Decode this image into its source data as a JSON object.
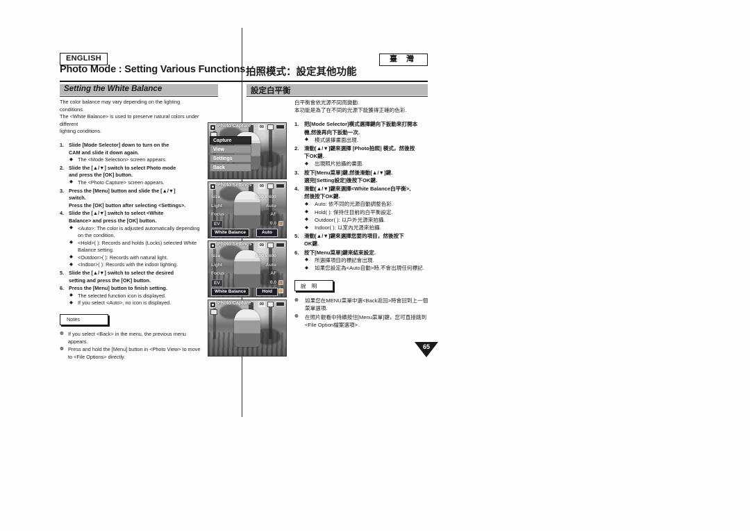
{
  "header": {
    "language_tag": "ENGLISH",
    "region_tag": "臺 灣",
    "title_en": "Photo Mode : Setting Various Functions",
    "title_zh": "拍照模式：設定其他功能"
  },
  "section": {
    "title_en": "Setting the White Balance",
    "title_zh": "設定白平衡"
  },
  "left": {
    "intro": [
      "The color balance may vary depending on the lighting conditions.",
      "The <White Balance> is used to preserve natural colors under different",
      "lighting conditions."
    ],
    "steps": [
      {
        "num": "1.",
        "lines": [
          "Slide [Mode Selector] down to turn on the",
          "CAM and slide it down again."
        ],
        "bullets": [
          "The <Mode Selection> screen appears."
        ]
      },
      {
        "num": "2.",
        "lines": [
          "Slide the [▲/▼] switch to select Photo mode",
          "and press the [OK] button."
        ],
        "bullets": [
          "The <Photo Capture> screen appears."
        ]
      },
      {
        "num": "3.",
        "lines": [
          "Press the [Menu] button and slide the [▲/▼]",
          "switch.",
          "Press the [OK] button after selecting <Settings>."
        ],
        "bullets": []
      },
      {
        "num": "4.",
        "lines": [
          "Slide the [▲/▼] switch to select <White",
          "Balance> and press the [OK] button."
        ],
        "bullets": [
          "<Auto>: The color is adjusted automatically depending on the condition.",
          "<Hold>( ): Records and holds (Locks) selected White Balance setting.",
          "<Outdoor>( ): Records with natural light.",
          "<Indoor>( ): Records with the indoor lighting."
        ]
      },
      {
        "num": "5.",
        "lines": [
          "Slide the [▲/▼] switch to select the desired",
          "setting and press the [OK] button."
        ],
        "bullets": []
      },
      {
        "num": "6.",
        "lines": [
          "Press the [Menu] button to finish setting."
        ],
        "bullets": [
          "The selected function icon is displayed.",
          "If you select <Auto>, no icon is displayed."
        ]
      }
    ],
    "notes_label": "Notes",
    "notes": [
      "If you select <Back> in the menu, the previous menu appears.",
      "Press and hold the [Menu] button in <Photo View> to move to <File Options> directly."
    ]
  },
  "right": {
    "intro": [
      "白平衡會依光源不同而變動.",
      "本功能是為了在不同的光源下能獲得正確的色彩."
    ],
    "steps": [
      {
        "num": "1.",
        "lines": [
          "把[Mode Selector]模式選擇鍵向下扳動來打開本",
          "機,然後再向下扳動一次."
        ],
        "bullets": [
          "模式選擇畫面出現."
        ]
      },
      {
        "num": "2.",
        "lines": [
          "滑動[▲/▼]鍵來選擇 [Photo拍照] 模式，然後按",
          "下OK鍵."
        ],
        "bullets": [
          "出現照片拍攝的畫面."
        ]
      },
      {
        "num": "3.",
        "lines": [
          "按下[Menu菜單]鍵,然後滑動[▲/▼]鍵.",
          "選完[Setting設定]後按下OK鍵."
        ],
        "bullets": []
      },
      {
        "num": "4.",
        "lines": [
          "滑動[▲/▼]鍵來選擇<White Balance白平衡>,",
          "然後按下OK鍵."
        ],
        "bullets": [
          "Auto: 依不同的光源自動調整色彩.",
          "Hold( ): 保持住目前的白平衡設定.",
          "Outdoor( ): 以戶外光源來拍攝.",
          "Indoor( ): 以室內光源來拍攝."
        ]
      },
      {
        "num": "5.",
        "lines": [
          "滑動[▲/▼]鍵來選擇您要的項目，然後按下",
          "OK鍵."
        ],
        "bullets": []
      },
      {
        "num": "6.",
        "lines": [
          "按下[Menu菜單]鍵來結束設定."
        ],
        "bullets": [
          "所選擇項目的標記會出現.",
          "如果您設定為<Auto自動>時,不會出現任何標記."
        ]
      }
    ],
    "notes_label": "說 明",
    "notes": [
      "如果您在MENU菜單中選<Back返回>時會回到上一個菜單選項.",
      "在照片觀看中持續按住[Menu菜單]鍵，您可直接跳到<File Option檔案選項>."
    ]
  },
  "screenshots": [
    {
      "step": "3",
      "lcd_title": "Photo Capture",
      "count": "00",
      "type": "menu",
      "items": [
        {
          "label": "Capture",
          "selected": true
        },
        {
          "label": "View",
          "selected": false
        },
        {
          "label": "Settings",
          "selected": false
        },
        {
          "label": "Back",
          "selected": false
        }
      ]
    },
    {
      "step": "4",
      "lcd_title": "Photo Settings",
      "count": "00",
      "type": "settings",
      "rows": [
        {
          "key": "Size",
          "value": "800 x 600",
          "selected": false
        },
        {
          "key": "Light",
          "value": "Auto",
          "selected": false
        },
        {
          "key": "Focus",
          "value": "AF",
          "selected": false
        },
        {
          "key": "EV",
          "value": "0.0",
          "selected": false,
          "chip": true
        },
        {
          "key": "White Balance",
          "value": "Auto",
          "selected": true
        }
      ]
    },
    {
      "step": "5",
      "lcd_title": "Photo Settings",
      "count": "00",
      "type": "settings",
      "rows": [
        {
          "key": "Size",
          "value": "800 x 600",
          "selected": false
        },
        {
          "key": "Light",
          "value": "Auto",
          "selected": false
        },
        {
          "key": "Focus",
          "value": "AF",
          "selected": false
        },
        {
          "key": "EV",
          "value": "0.0",
          "selected": false,
          "chip": true
        },
        {
          "key": "White Balance",
          "value": "Hold",
          "selected": true
        }
      ]
    },
    {
      "step": "6",
      "lcd_title": "Photo Capture",
      "count": "00",
      "type": "preview",
      "rows": []
    }
  ],
  "page_number": "65"
}
